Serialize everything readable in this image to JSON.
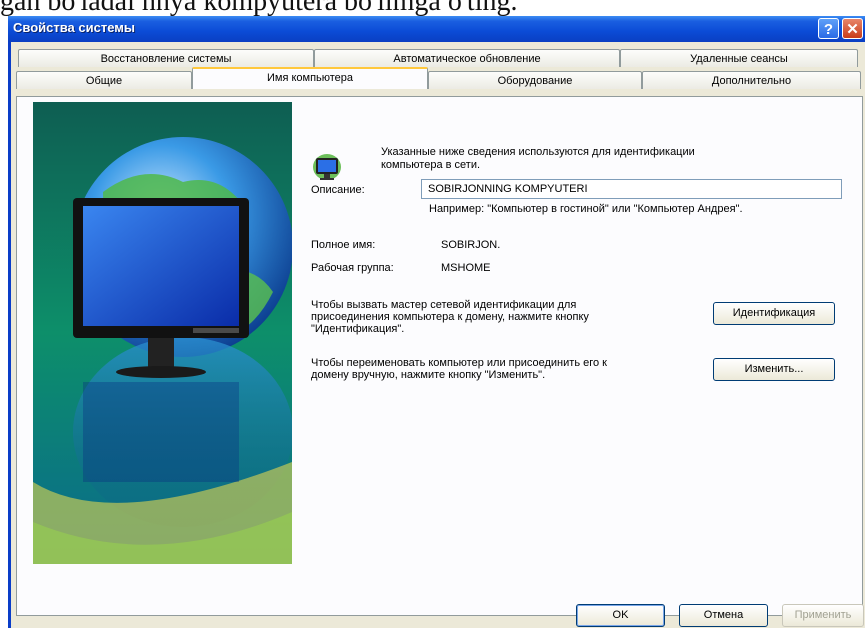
{
  "doc_text": "gan bo'ladai nnya kompyutera bo'iimga o'ting.",
  "window": {
    "title": "Свойства системы",
    "help_label": "?",
    "close_label": "✕"
  },
  "tabs_row1": [
    {
      "label": "Восстановление системы"
    },
    {
      "label": "Автоматическое обновление"
    },
    {
      "label": "Удаленные сеансы"
    }
  ],
  "tabs_row2": [
    {
      "label": "Общие"
    },
    {
      "label": "Имя компьютера",
      "active": true
    },
    {
      "label": "Оборудование"
    },
    {
      "label": "Дополнительно"
    }
  ],
  "content": {
    "intro_line1": "Указанные ниже сведения используются для идентификации",
    "intro_line2": "компьютера в сети.",
    "description_label": "Описание:",
    "description_value": "SOBIRJONNING KOMPYUTERI",
    "example_text": "Например: \"Компьютер в гостиной\" или \"Компьютер Андрея\".",
    "fullname_label": "Полное имя:",
    "fullname_value": "SOBIRJON.",
    "workgroup_label": "Рабочая группа:",
    "workgroup_value": "MSHOME",
    "wizard_line1": "Чтобы вызвать мастер сетевой идентификации для",
    "wizard_line2": "присоединения компьютера к домену, нажмите кнопку",
    "wizard_line3": "\"Идентификация\".",
    "ident_button": "Идентификация",
    "rename_line1": "Чтобы переименовать компьютер или присоединить его к",
    "rename_line2": "домену вручную, нажмите кнопку \"Изменить\".",
    "change_button": "Изменить..."
  },
  "footer": {
    "ok": "OK",
    "cancel": "Отмена",
    "apply": "Применить"
  }
}
